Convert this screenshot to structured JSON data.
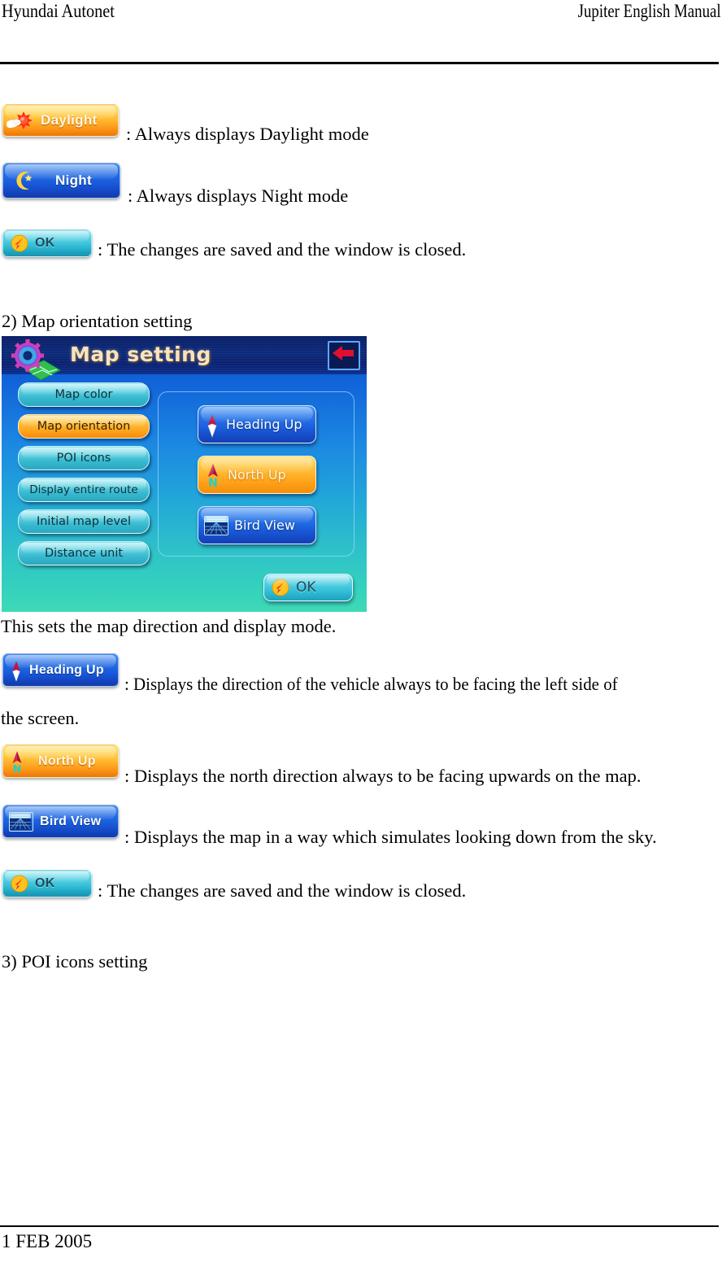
{
  "header": {
    "left": "Hyundai Autonet",
    "right": "Jupiter English Manual"
  },
  "footer": {
    "date": "1 FEB 2005"
  },
  "body": {
    "daylight_button_label": "Daylight",
    "daylight_desc": ": Always displays Daylight mode",
    "night_button_label": "Night",
    "night_desc": ": Always displays Night mode",
    "ok_button_label": "OK",
    "ok_desc_1": ": The changes are saved and the window is closed.",
    "section_2_heading": "2) Map orientation setting",
    "caption_after_image": "This sets the map direction and display mode.",
    "heading_up_button_label": "Heading Up",
    "heading_up_desc_line1": ": Displays the direction of the vehicle always to be facing the left side of",
    "heading_up_desc_line2": "the screen.",
    "north_up_button_label": "North Up",
    "north_up_desc": ": Displays the north direction always to be facing upwards on the map.",
    "bird_view_button_label": "Bird View",
    "bird_view_desc": ": Displays the map in a way which simulates looking down from the sky.",
    "ok_desc_2": ": The changes are saved and the window is closed.",
    "section_3_heading": "3) POI icons setting"
  },
  "screenshot": {
    "title": "Map setting",
    "menu_items": [
      {
        "label": "Map color",
        "selected": false
      },
      {
        "label": "Map orientation",
        "selected": true
      },
      {
        "label": "POI icons",
        "selected": false
      },
      {
        "label": "Display entire route",
        "selected": false
      },
      {
        "label": "Initial map level",
        "selected": false
      },
      {
        "label": "Distance unit",
        "selected": false
      }
    ],
    "options": [
      {
        "label": "Heading Up",
        "selected": false
      },
      {
        "label": "North Up",
        "selected": true
      },
      {
        "label": "Bird View",
        "selected": false
      }
    ],
    "ok_label": "OK"
  },
  "colors": {
    "selected_orange": "#ffa41c",
    "menu_teal": "#36b9cf",
    "option_blue": "#1a5ddd",
    "title_navy": "#0c2a7a",
    "title_text": "#f6e3c3",
    "back_arrow_red": "#e01030",
    "ok_cyan": "#39c2d9"
  }
}
